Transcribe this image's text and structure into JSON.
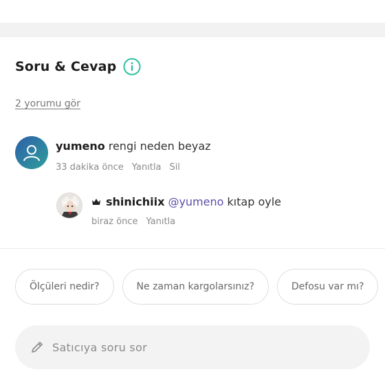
{
  "section": {
    "title": "Soru & Cevap",
    "see_comments": "2 yorumu gör"
  },
  "comments": [
    {
      "username": "yumeno",
      "text": "rengi neden beyaz",
      "time": "33 dakika önce",
      "actions": [
        "Yanıtla",
        "Sil"
      ],
      "avatar_icon": "user-icon"
    },
    {
      "username": "shinichiix",
      "badge_icon": "crown-icon",
      "mention": "@yumeno",
      "text": "kıtap oyle",
      "time": "biraz önce",
      "actions": [
        "Yanıtla"
      ],
      "avatar_icon": "profile-photo"
    }
  ],
  "quick_questions": [
    "Ölçüleri nedir?",
    "Ne zaman kargolarsınız?",
    "Defosu var mı?"
  ],
  "ask_input": {
    "placeholder": "Satıcıya soru sor",
    "icon": "pencil-icon"
  },
  "colors": {
    "accent_teal": "#2fbfa0",
    "mention": "#5a4ea8",
    "muted": "#8a8a8a"
  }
}
